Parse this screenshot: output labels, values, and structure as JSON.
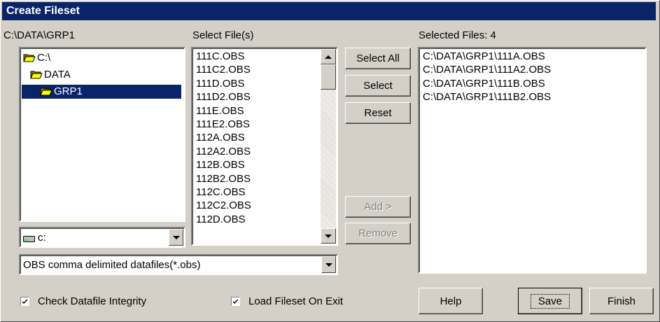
{
  "window": {
    "title": "Create Fileset"
  },
  "directory": {
    "current_path": "C:\\DATA\\GRP1",
    "tree": [
      {
        "label": "C:\\",
        "icon": "folder-open-icon",
        "selected": false
      },
      {
        "label": "DATA",
        "icon": "folder-open-icon",
        "selected": false
      },
      {
        "label": "GRP1",
        "icon": "folder-open-icon",
        "selected": true
      }
    ],
    "drive": {
      "value": "c:",
      "icon": "drive-icon"
    }
  },
  "file_list": {
    "label": "Select File(s)",
    "items": [
      "111C.OBS",
      "111C2.OBS",
      "111D.OBS",
      "111D2.OBS",
      "111E.OBS",
      "111E2.OBS",
      "112A.OBS",
      "112A2.OBS",
      "112B.OBS",
      "112B2.OBS",
      "112C.OBS",
      "112C2.OBS",
      "112D.OBS"
    ]
  },
  "file_type": {
    "value": "OBS comma delimited datafiles(*.obs)"
  },
  "middle_buttons": {
    "select_all": "Select All",
    "select": "Select",
    "reset": "Reset",
    "add": "Add >",
    "remove": "Remove"
  },
  "selected": {
    "label": "Selected Files: 4",
    "items": [
      "C:\\DATA\\GRP1\\111A.OBS",
      "C:\\DATA\\GRP1\\111A2.OBS",
      "C:\\DATA\\GRP1\\111B.OBS",
      "C:\\DATA\\GRP1\\111B2.OBS"
    ]
  },
  "options": {
    "check_integrity": {
      "label": "Check Datafile Integrity",
      "checked": true
    },
    "load_on_exit": {
      "label": "Load Fileset On Exit",
      "checked": true
    }
  },
  "bottom_buttons": {
    "help": "Help",
    "save": "Save",
    "finish": "Finish"
  },
  "colors": {
    "title_bg": "#0a246a",
    "face": "#d4d0c8",
    "selection": "#0a246a"
  }
}
